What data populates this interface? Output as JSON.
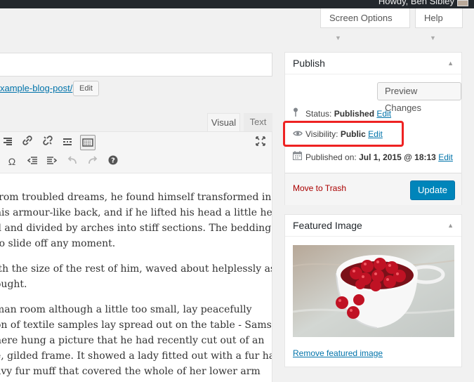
{
  "adminbar": {
    "howdy": "Howdy, Ben Sibley"
  },
  "screen_meta": {
    "screen_options": "Screen Options",
    "help": "Help"
  },
  "permalink": {
    "slug_text": "xample-blog-post/",
    "edit_label": "Edit"
  },
  "editor": {
    "tabs": {
      "visual": "Visual",
      "text": "Text"
    },
    "paragraphs": [
      [
        " from troubled dreams, he found himself transformed in",
        " his armour-like back, and if he lifted his head a little he",
        "d and divided by arches into stiff sections. The bedding was",
        " to slide off any moment."
      ],
      [
        "ith the size of the rest of him, waved about helplessly as he",
        "ought."
      ],
      [
        "man room although a little too small, lay peacefully",
        "on of textile samples lay spread out on the table - Samsa",
        "here hung a picture that he had recently cut out of an",
        "e, gilded frame. It showed a lady fitted out with a fur hat",
        "avy fur muff that covered the whole of her lower arm"
      ]
    ]
  },
  "publish": {
    "title": "Publish",
    "preview_label": "Preview Changes",
    "status": {
      "label": "Status:",
      "value": "Published",
      "edit": "Edit"
    },
    "visibility": {
      "label": "Visibility:",
      "value": "Public",
      "edit": "Edit"
    },
    "published_on": {
      "label": "Published on:",
      "value": "Jul 1, 2015 @ 18:13",
      "edit": "Edit"
    },
    "trash_label": "Move to Trash",
    "update_label": "Update"
  },
  "featured": {
    "title": "Featured Image",
    "remove_label": "Remove featured image"
  },
  "colors": {
    "accent": "#0085ba",
    "highlight": "#e22222",
    "link": "#0073aa",
    "trash": "#aa0000"
  }
}
